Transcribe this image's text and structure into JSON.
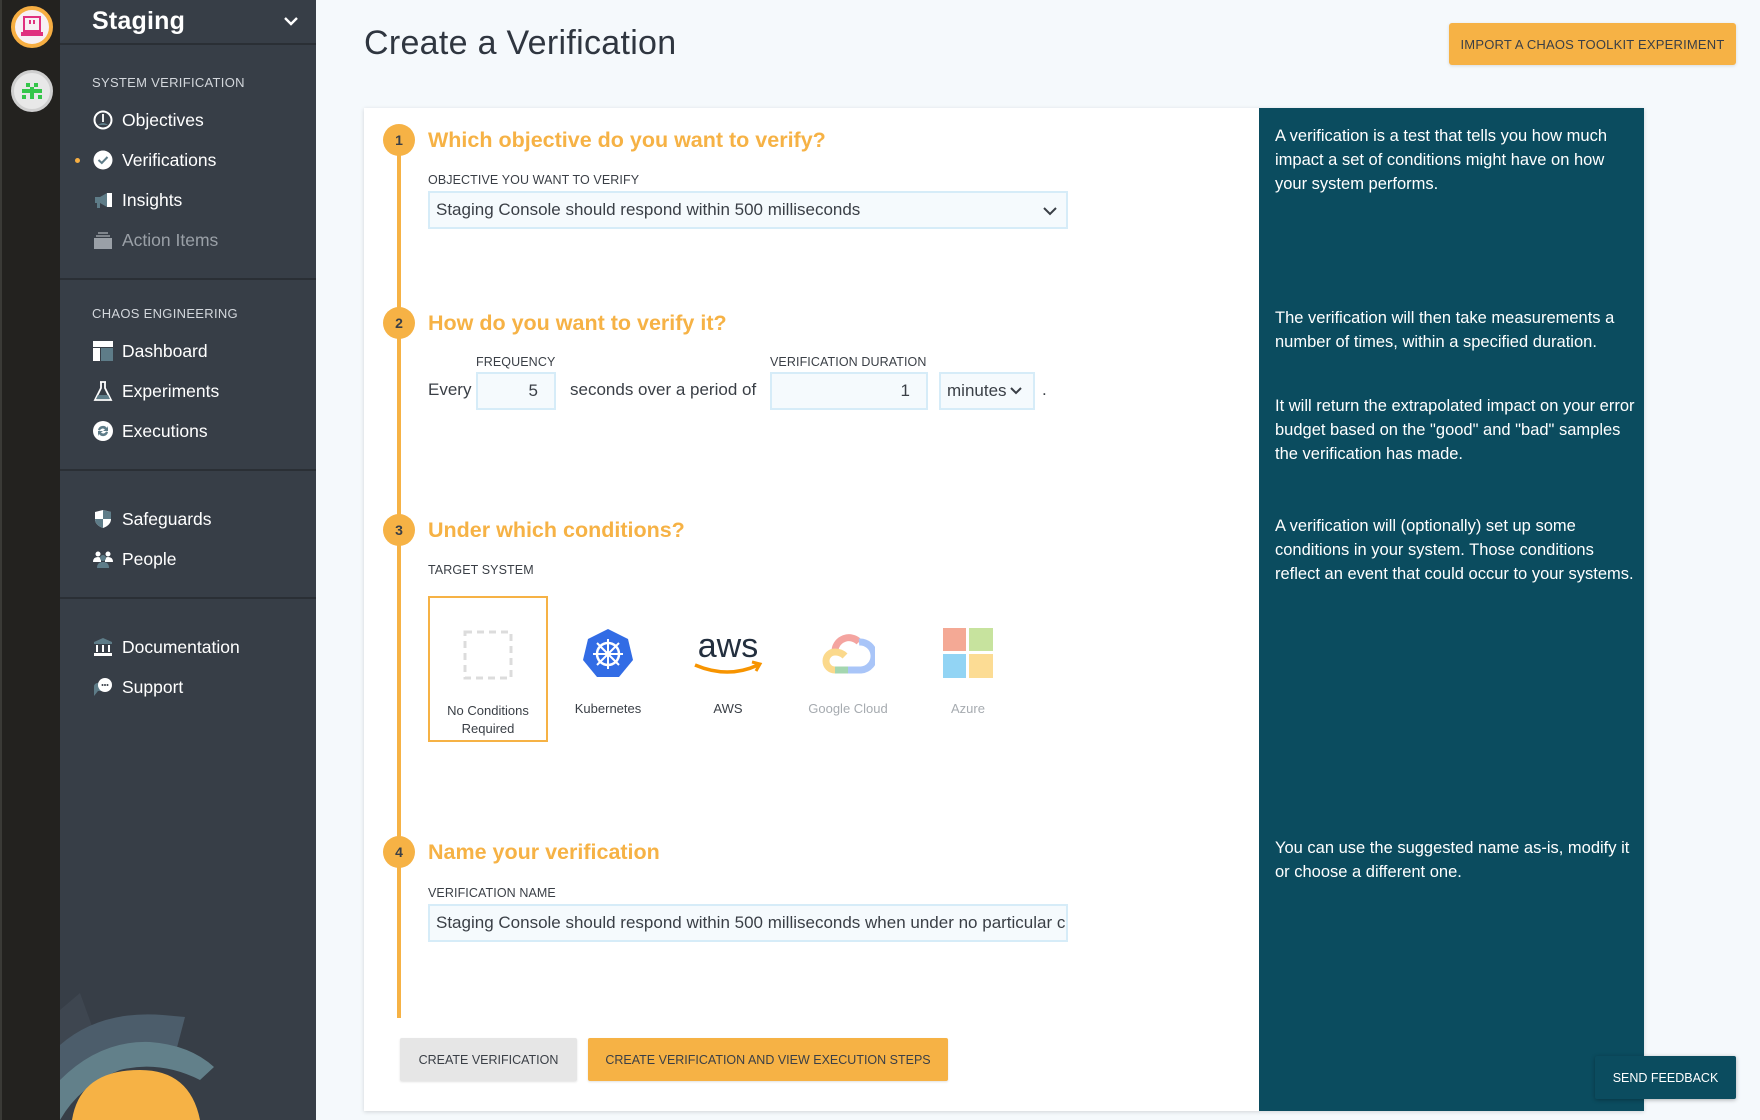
{
  "rail": {
    "orgs": [
      {
        "name": "organization-avatar-primary",
        "color": "#e0307f"
      },
      {
        "name": "organization-avatar-secondary",
        "color": "#35c64a"
      }
    ]
  },
  "sidebar": {
    "org_name": "Staging",
    "sections": [
      {
        "heading": "SYSTEM VERIFICATION",
        "items": [
          {
            "label": "Objectives",
            "icon": "objectives-icon",
            "active": false,
            "disabled": false
          },
          {
            "label": "Verifications",
            "icon": "check-circle-icon",
            "active": true,
            "disabled": false
          },
          {
            "label": "Insights",
            "icon": "megaphone-icon",
            "active": false,
            "disabled": false
          },
          {
            "label": "Action Items",
            "icon": "inbox-stack-icon",
            "active": false,
            "disabled": true
          }
        ]
      },
      {
        "heading": "CHAOS ENGINEERING",
        "items": [
          {
            "label": "Dashboard",
            "icon": "dashboard-icon"
          },
          {
            "label": "Experiments",
            "icon": "flask-icon"
          },
          {
            "label": "Executions",
            "icon": "refresh-icon"
          }
        ]
      },
      {
        "heading": "",
        "items": [
          {
            "label": "Safeguards",
            "icon": "shield-icon"
          },
          {
            "label": "People",
            "icon": "people-icon"
          }
        ]
      },
      {
        "heading": "",
        "items": [
          {
            "label": "Documentation",
            "icon": "library-icon"
          },
          {
            "label": "Support",
            "icon": "chat-bubble-icon"
          }
        ]
      }
    ]
  },
  "header": {
    "title": "Create a Verification",
    "import_button": "IMPORT A CHAOS TOOLKIT EXPERIMENT"
  },
  "steps": [
    {
      "number": "1",
      "title": "Which objective do you want to verify?",
      "field_label": "OBJECTIVE YOU WANT TO VERIFY",
      "selected_objective": "Staging Console should respond within 500 milliseconds"
    },
    {
      "number": "2",
      "title": "How do you want to verify it?",
      "frequency_label": "FREQUENCY",
      "duration_label": "VERIFICATION DURATION",
      "text_every": "Every",
      "frequency_value": "5",
      "text_mid": "seconds over a period of",
      "duration_value": "1",
      "duration_unit": "minutes",
      "text_end": "."
    },
    {
      "number": "3",
      "title": "Under which conditions?",
      "field_label": "TARGET SYSTEM",
      "targets": [
        {
          "label": "No Conditions Required",
          "icon": "empty-dashed-square-icon",
          "selected": true,
          "enabled": true
        },
        {
          "label": "Kubernetes",
          "icon": "kubernetes-icon",
          "selected": false,
          "enabled": true
        },
        {
          "label": "AWS",
          "icon": "aws-icon",
          "selected": false,
          "enabled": true
        },
        {
          "label": "Google Cloud",
          "icon": "google-cloud-icon",
          "selected": false,
          "enabled": false
        },
        {
          "label": "Azure",
          "icon": "azure-icon",
          "selected": false,
          "enabled": false
        }
      ]
    },
    {
      "number": "4",
      "title": "Name your verification",
      "field_label": "VERIFICATION NAME",
      "name_value": "Staging Console should respond within 500 milliseconds when under no particular conditions"
    }
  ],
  "actions": {
    "create": "CREATE VERIFICATION",
    "create_and_view": "CREATE VERIFICATION AND VIEW EXECUTION STEPS"
  },
  "help": {
    "p1": "A verification is a test that tells you how much impact a set of conditions might have on how your system performs.",
    "p2": "The verification will then take measurements a number of times, within a specified duration.",
    "p3": "It will return the extrapolated impact on your error budget based on the \"good\" and \"bad\" samples the verification has made.",
    "p4": "A verification will (optionally) set up some conditions in your system. Those conditions reflect an event that could occur to your systems.",
    "p5": "You can use the suggested name as-is, modify it or choose a different one."
  },
  "feedback_button": "SEND FEEDBACK",
  "colors": {
    "accent": "#f6b245",
    "help_panel": "#0b4c5f",
    "sidebar": "#373e47",
    "rail": "#23221f"
  }
}
